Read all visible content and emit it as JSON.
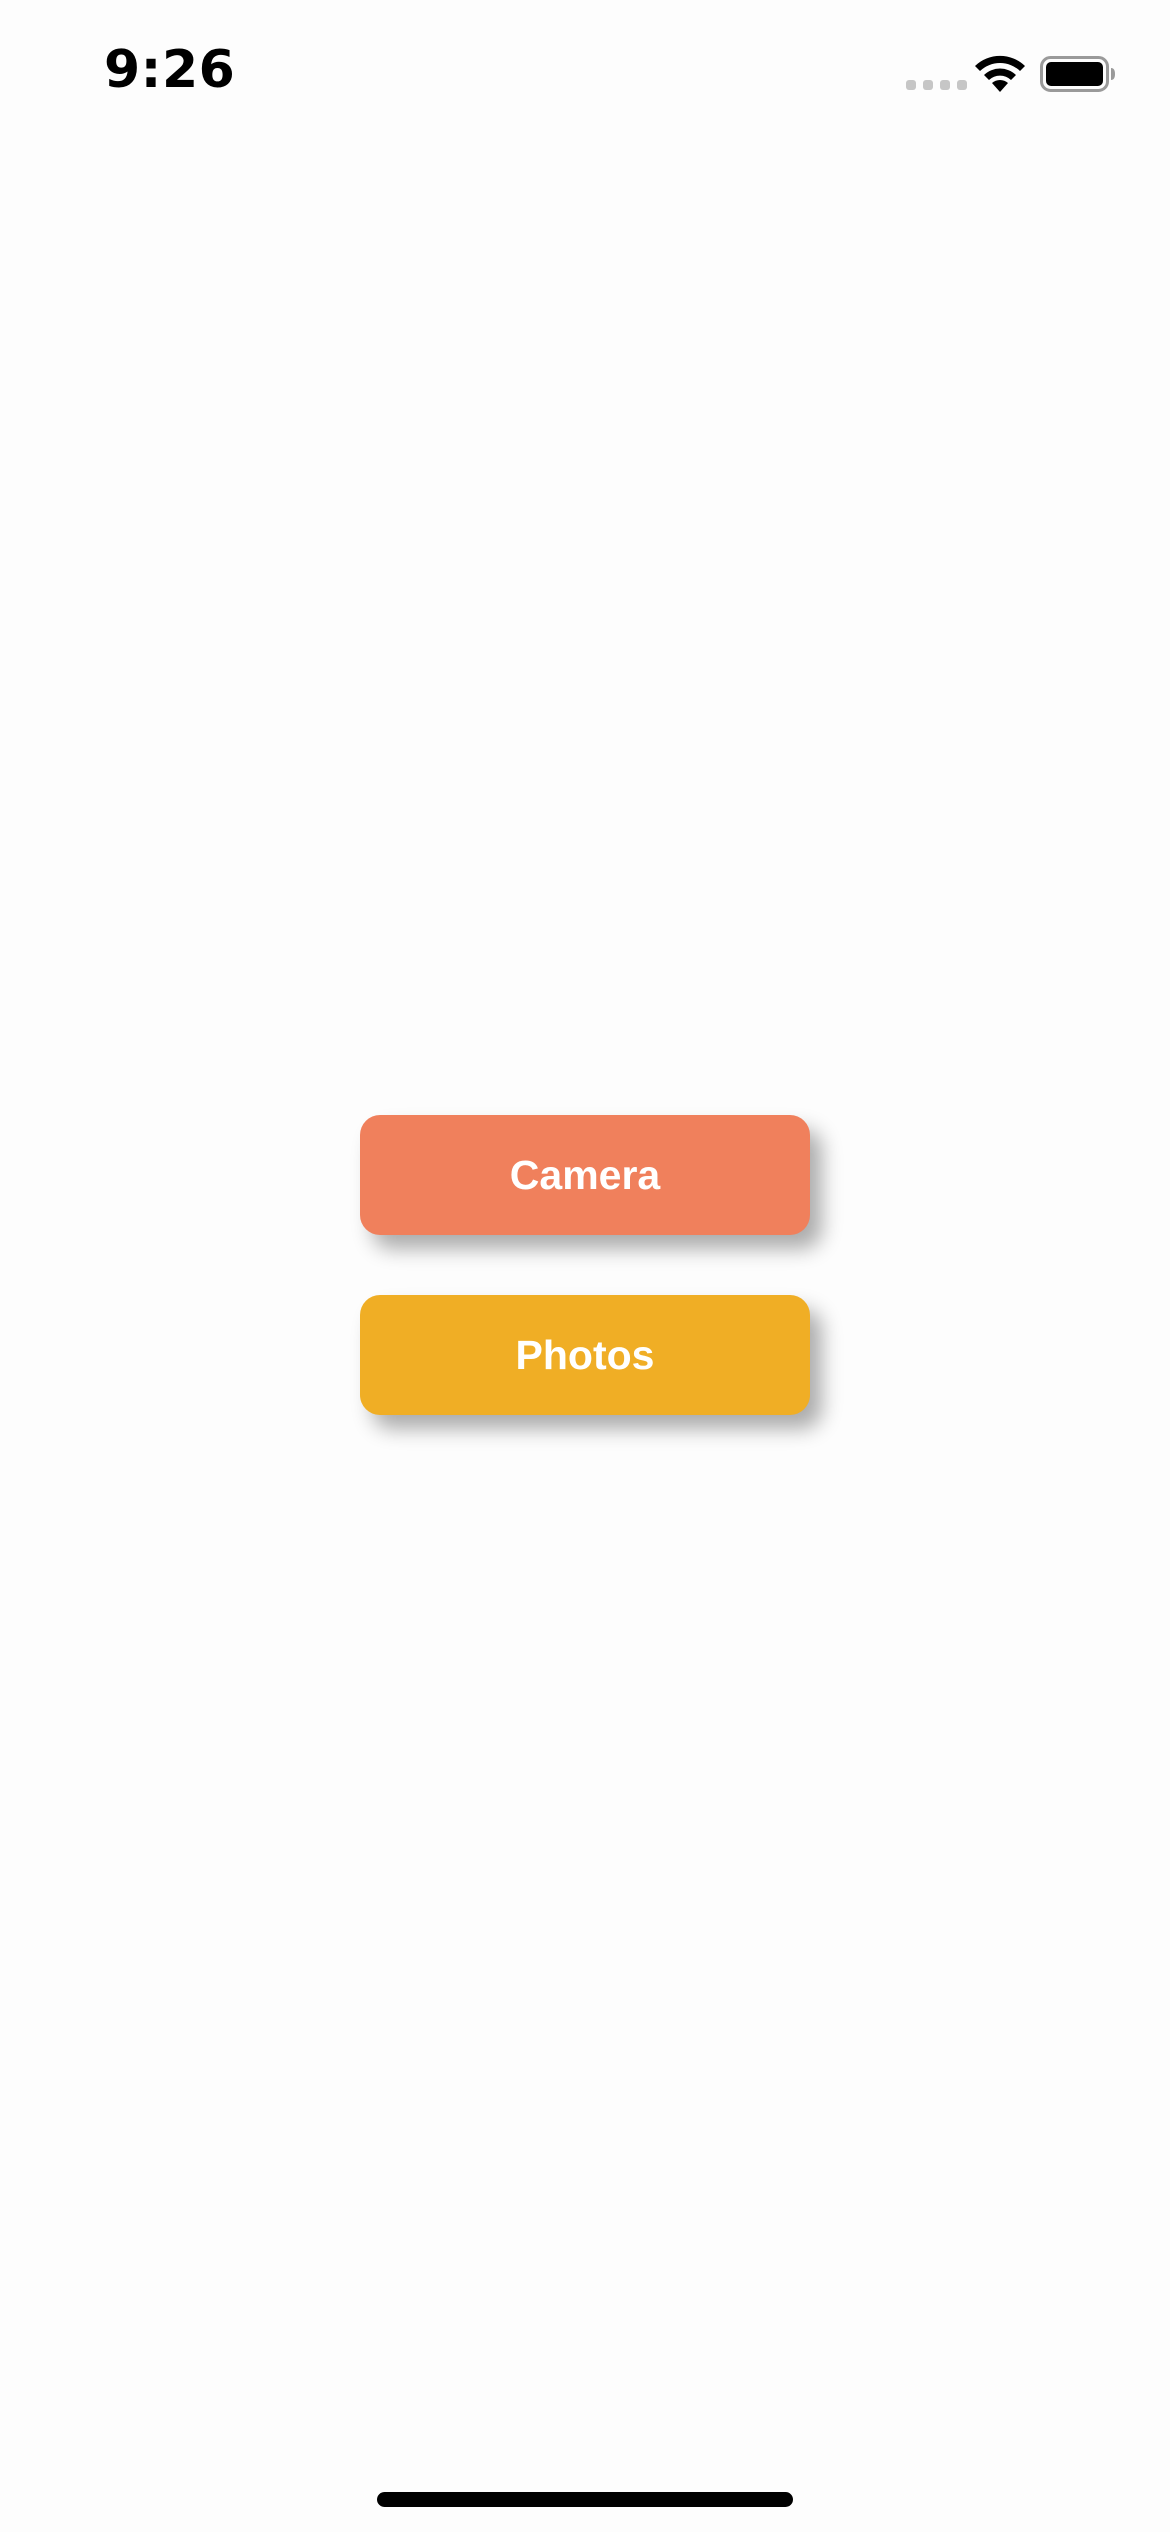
{
  "status_bar": {
    "time": "9:26",
    "icons": [
      "cellular-signal-icon",
      "wifi-icon",
      "battery-icon"
    ]
  },
  "buttons": {
    "camera_label": "Camera",
    "photos_label": "Photos"
  },
  "colors": {
    "camera": "#f0805c",
    "photos": "#f0ae25",
    "background": "#fdfdfd",
    "text": "#ffffff"
  }
}
